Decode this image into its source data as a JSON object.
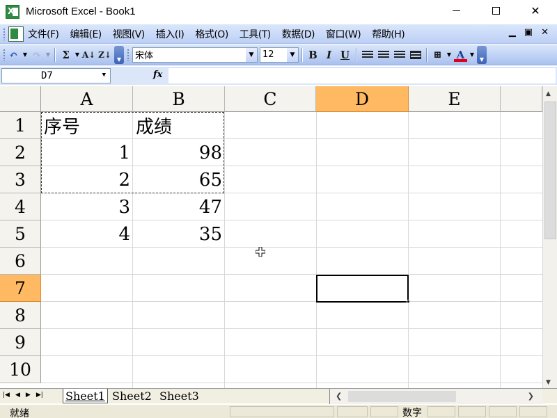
{
  "window": {
    "title": "Microsoft Excel - Book1"
  },
  "menu": {
    "items": [
      "文件(F)",
      "编辑(E)",
      "视图(V)",
      "插入(I)",
      "格式(O)",
      "工具(T)",
      "数据(D)",
      "窗口(W)",
      "帮助(H)"
    ]
  },
  "toolbar": {
    "sigma": "Σ",
    "font_name": "宋体",
    "font_size": "12",
    "bold": "B",
    "italic": "I",
    "underline": "U",
    "font_color_letter": "A",
    "font_color_bar": "#e0001b"
  },
  "formula_bar": {
    "name_box": "D7",
    "fx": "fx",
    "value": ""
  },
  "sheet": {
    "columns": [
      "A",
      "B",
      "C",
      "D",
      "E"
    ],
    "rows": [
      "1",
      "2",
      "3",
      "4",
      "5",
      "6",
      "7",
      "8",
      "9",
      "10"
    ],
    "active_cell": "D7",
    "cells": {
      "A1": "序号",
      "B1": "成绩",
      "A2": "1",
      "B2": "98",
      "A3": "2",
      "B3": "65",
      "A4": "3",
      "B4": "47",
      "A5": "4",
      "B5": "35"
    },
    "highlight_color": "#ffb963"
  },
  "tabs": [
    "Sheet1",
    "Sheet2",
    "Sheet3"
  ],
  "status": {
    "ready": "就绪",
    "numeric": "数字"
  }
}
